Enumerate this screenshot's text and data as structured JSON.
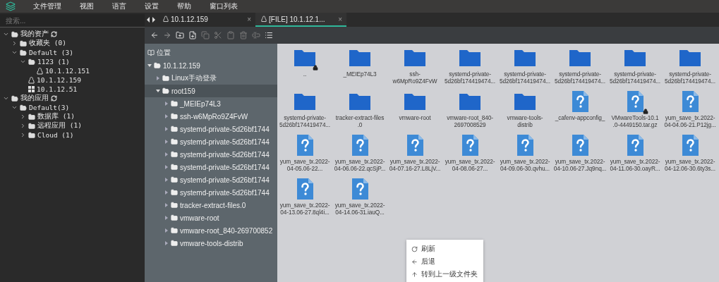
{
  "menu": [
    "文件管理",
    "视图",
    "语言",
    "设置",
    "帮助",
    "窗口列表"
  ],
  "assets": {
    "search": {
      "placeholder": "搜索..."
    },
    "tree": [
      {
        "label": "我的资产",
        "kind": "root",
        "expanded": true,
        "children": [
          {
            "label": "收藏夹 (0)",
            "kind": "folder",
            "expanded": false
          },
          {
            "label": "Default (3)",
            "kind": "folder",
            "expanded": true,
            "children": [
              {
                "label": "1123 (1)",
                "kind": "folder",
                "expanded": true,
                "children": [
                  {
                    "label": "10.1.12.151",
                    "kind": "linux"
                  }
                ]
              },
              {
                "label": "10.1.12.159",
                "kind": "linux"
              },
              {
                "label": "10.1.12.51",
                "kind": "windows"
              }
            ]
          }
        ]
      },
      {
        "label": "我的应用",
        "kind": "root",
        "expanded": true,
        "children": [
          {
            "label": "Default(3)",
            "kind": "folder",
            "expanded": true,
            "children": [
              {
                "label": "数据库 (1)",
                "kind": "folder",
                "expanded": false
              },
              {
                "label": "远程应用 (1)",
                "kind": "folder",
                "expanded": false
              },
              {
                "label": "Cloud (1)",
                "kind": "folder",
                "expanded": false
              }
            ]
          }
        ]
      }
    ]
  },
  "tabs": [
    {
      "label": "10.1.12.159",
      "selected": false,
      "close": "×"
    },
    {
      "label": "[FILE] 10.1.12.1...",
      "selected": true,
      "close": "×"
    }
  ],
  "places": {
    "heading": "位置",
    "tree": [
      {
        "label": "10.1.12.159",
        "expanded": true,
        "selected": false,
        "children": [
          {
            "label": "Linux手动登录",
            "expanded": false,
            "selected": false
          },
          {
            "label": "root159",
            "expanded": true,
            "selected": true,
            "children": [
              {
                "label": "_MEIEp74L3",
                "expanded": false,
                "selected": false
              },
              {
                "label": "ssh-w6MpRo9Z4FvW",
                "expanded": false,
                "selected": false
              },
              {
                "label": "systemd-private-5d26bf1744",
                "expanded": false,
                "selected": false
              },
              {
                "label": "systemd-private-5d26bf1744",
                "expanded": false,
                "selected": false
              },
              {
                "label": "systemd-private-5d26bf1744",
                "expanded": false,
                "selected": false
              },
              {
                "label": "systemd-private-5d26bf1744",
                "expanded": false,
                "selected": false
              },
              {
                "label": "systemd-private-5d26bf1744",
                "expanded": false,
                "selected": false
              },
              {
                "label": "systemd-private-5d26bf1744",
                "expanded": false,
                "selected": false
              },
              {
                "label": "tracker-extract-files.0",
                "expanded": false,
                "selected": false
              },
              {
                "label": "vmware-root",
                "expanded": false,
                "selected": false
              },
              {
                "label": "vmware-root_840-269700852",
                "expanded": false,
                "selected": false
              },
              {
                "label": "vmware-tools-distrib",
                "expanded": false,
                "selected": false
              }
            ]
          }
        ]
      }
    ]
  },
  "files": [
    {
      "lines": [
        ".."
      ],
      "kind": "folder",
      "locked": true
    },
    {
      "lines": [
        "_MEIEp74L3"
      ],
      "kind": "folder",
      "locked": false
    },
    {
      "lines": [
        "ssh-",
        "w6MpRo9Z4FvW"
      ],
      "kind": "folder",
      "locked": false
    },
    {
      "lines": [
        "systemd-private-",
        "5d26bf174419474..."
      ],
      "kind": "folder",
      "locked": false
    },
    {
      "lines": [
        "systemd-private-",
        "5d26bf174419474..."
      ],
      "kind": "folder",
      "locked": false
    },
    {
      "lines": [
        "systemd-private-",
        "5d26bf174419474..."
      ],
      "kind": "folder",
      "locked": false
    },
    {
      "lines": [
        "systemd-private-",
        "5d26bf174419474..."
      ],
      "kind": "folder",
      "locked": false
    },
    {
      "lines": [
        "systemd-private-",
        "5d26bf174419474..."
      ],
      "kind": "folder",
      "locked": false
    },
    {
      "lines": [
        "systemd-private-",
        "5d26bf174419474..."
      ],
      "kind": "folder",
      "locked": false
    },
    {
      "lines": [
        "tracker-extract-files",
        ".0"
      ],
      "kind": "folder",
      "locked": false
    },
    {
      "lines": [
        "vmware-root"
      ],
      "kind": "folder",
      "locked": false
    },
    {
      "lines": [
        "vmware-root_840-",
        "2697008529"
      ],
      "kind": "folder",
      "locked": false
    },
    {
      "lines": [
        "vmware-tools-",
        "distrib"
      ],
      "kind": "folder",
      "locked": false
    },
    {
      "lines": [
        "_cafenv-appconfig_"
      ],
      "kind": "unknown",
      "locked": false
    },
    {
      "lines": [
        "VMwareTools-10.1",
        ".0-4449150.tar.gz"
      ],
      "kind": "unknown",
      "locked": true
    },
    {
      "lines": [
        "yum_save_tx.2022-",
        "04-04.06-21.P12jg..."
      ],
      "kind": "unknown",
      "locked": false
    },
    {
      "lines": [
        "yum_save_tx.2022-",
        "04-05.06-22..."
      ],
      "kind": "unknown",
      "locked": false
    },
    {
      "lines": [
        "yum_save_tx.2022-",
        "04-06.06-22.qcSjP..."
      ],
      "kind": "unknown",
      "locked": false
    },
    {
      "lines": [
        "yum_save_tx.2022-",
        "04-07.16-27.L8LjV..."
      ],
      "kind": "unknown",
      "locked": false
    },
    {
      "lines": [
        "yum_save_tx.2022-",
        "04-08.06-27..."
      ],
      "kind": "unknown",
      "locked": false
    },
    {
      "lines": [
        "yum_save_tx.2022-",
        "04-09.06-30.qvhu..."
      ],
      "kind": "unknown",
      "locked": false
    },
    {
      "lines": [
        "yum_save_tx.2022-",
        "04-10.06-27.Jq9nq..."
      ],
      "kind": "unknown",
      "locked": false
    },
    {
      "lines": [
        "yum_save_tx.2022-",
        "04-11.06-30.oayR..."
      ],
      "kind": "unknown",
      "locked": false
    },
    {
      "lines": [
        "yum_save_tx.2022-",
        "04-12.06-30.6ty3s..."
      ],
      "kind": "unknown",
      "locked": false
    },
    {
      "lines": [
        "yum_save_tx.2022-",
        "04-13.06-27.8ql4i..."
      ],
      "kind": "unknown",
      "locked": false
    },
    {
      "lines": [
        "yum_save_tx.2022-",
        "04-14.06-31.iauQ..."
      ],
      "kind": "unknown",
      "locked": false
    }
  ],
  "context_menu": [
    {
      "label": "刷新",
      "kind": "refresh"
    },
    {
      "label": "后退",
      "kind": "back"
    },
    {
      "label": "转到上一级文件夹",
      "kind": "up"
    }
  ]
}
